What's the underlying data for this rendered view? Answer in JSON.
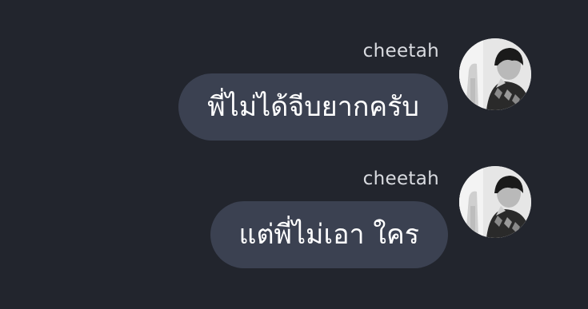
{
  "background_color": "#22252d",
  "bubble_color": "#3b4151",
  "messages": [
    {
      "sender": "cheetah",
      "text": "พี่ไม่ได้จีบยากครับ",
      "avatar_icon": "user-avatar-icon"
    },
    {
      "sender": "cheetah",
      "text": "แต่พี่ไม่เอา ใคร",
      "avatar_icon": "user-avatar-icon"
    }
  ]
}
